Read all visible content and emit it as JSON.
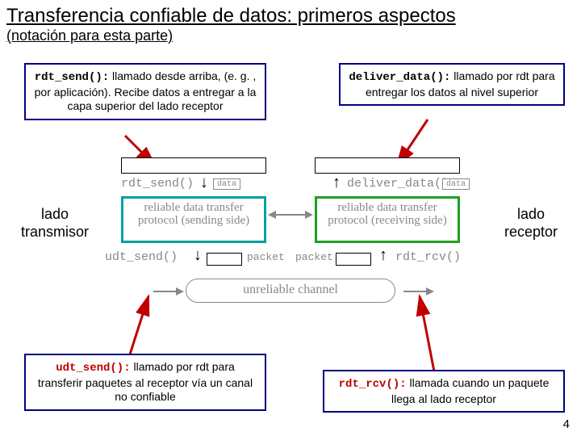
{
  "title": "Transferencia confiable de datos: primeros aspectos",
  "subtitle": "(notación para esta parte)",
  "boxes": {
    "rdt_send": {
      "code": "rdt_send():",
      "text": " llamado desde arriba, (e. g. , por aplicación). Recibe datos a entregar a la capa superior del lado receptor"
    },
    "deliver_data": {
      "code": "deliver_data():",
      "text": " llamado por rdt para entregar los datos al nivel superior"
    },
    "udt_send": {
      "code": "udt_send():",
      "text": " llamado por rdt para transferir paquetes al receptor vía un canal no confiable"
    },
    "rdt_rcv": {
      "code": "rdt_rcv():",
      "text": " llamada cuando un paquete llega al lado receptor"
    }
  },
  "side": {
    "left": "lado transmisor",
    "right": "lado receptor"
  },
  "fig": {
    "rdt_send": "rdt_send()",
    "deliver_data": "deliver_data()",
    "udt_send": "udt_send()",
    "rdt_rcv": "rdt_rcv()",
    "data": "data",
    "packet": "packet",
    "proto_send": "reliable data transfer protocol (sending side)",
    "proto_recv": "reliable data transfer protocol (receiving side)",
    "channel": "unreliable channel"
  },
  "page": "4"
}
